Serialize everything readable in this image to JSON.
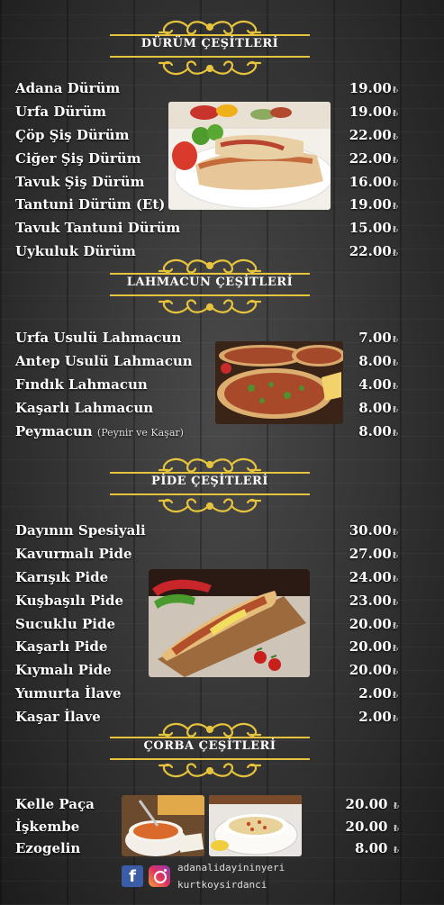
{
  "sections": {
    "durum": {
      "title": "DÜRÜM ÇEŞİTLERİ",
      "items": [
        {
          "name": "Adana Dürüm",
          "price": "19.00"
        },
        {
          "name": "Urfa Dürüm",
          "price": "19.00"
        },
        {
          "name": "Çöp Şiş Dürüm",
          "price": "22.00"
        },
        {
          "name": "Ciğer Şiş Dürüm",
          "price": "22.00"
        },
        {
          "name": "Tavuk Şiş Dürüm",
          "price": "16.00"
        },
        {
          "name": "Tantuni Dürüm (Et)",
          "price": "19.00"
        },
        {
          "name": "Tavuk Tantuni Dürüm",
          "price": "15.00"
        },
        {
          "name": "Uykuluk Dürüm",
          "price": "22.00"
        }
      ]
    },
    "lahmacun": {
      "title": "LAHMACUN ÇEŞİTLERİ",
      "items": [
        {
          "name": "Urfa Usulü Lahmacun",
          "price": "7.00"
        },
        {
          "name": "Antep Usulü Lahmacun",
          "price": "8.00"
        },
        {
          "name": "Fındık Lahmacun",
          "price": "4.00"
        },
        {
          "name": "Kaşarlı Lahmacun",
          "price": "8.00"
        },
        {
          "name": "Peymacun",
          "note": "(Peynir ve Kaşar)",
          "price": "8.00"
        }
      ]
    },
    "pide": {
      "title": "PİDE ÇEŞİTLERİ",
      "items": [
        {
          "name": "Dayının Spesiyali",
          "price": "30.00"
        },
        {
          "name": "Kavurmalı Pide",
          "price": "27.00"
        },
        {
          "name": "Karışık Pide",
          "price": "24.00"
        },
        {
          "name": "Kuşbaşılı Pide",
          "price": "23.00"
        },
        {
          "name": "Sucuklu Pide",
          "price": "20.00"
        },
        {
          "name": "Kaşarlı Pide",
          "price": "20.00"
        },
        {
          "name": "Kıymalı Pide",
          "price": "20.00"
        },
        {
          "name": "Yumurta İlave",
          "price": "2.00"
        },
        {
          "name": "Kaşar İlave",
          "price": "2.00"
        }
      ]
    },
    "corba": {
      "title": "ÇORBA ÇEŞİTLERİ",
      "items": [
        {
          "name": "Kelle Paça",
          "price": "20.00"
        },
        {
          "name": "İşkembe",
          "price": "20.00"
        },
        {
          "name": "Ezogelin",
          "price": "8.00"
        }
      ]
    }
  },
  "currency_symbol": "₺",
  "social": {
    "facebook_icon": "facebook-icon",
    "instagram_icon": "instagram-icon",
    "handles": [
      "adanalidayininyeri",
      "kurtkoysirdanci"
    ]
  },
  "colors": {
    "accent_gold": "#e6c33c",
    "text": "#ffffff"
  }
}
